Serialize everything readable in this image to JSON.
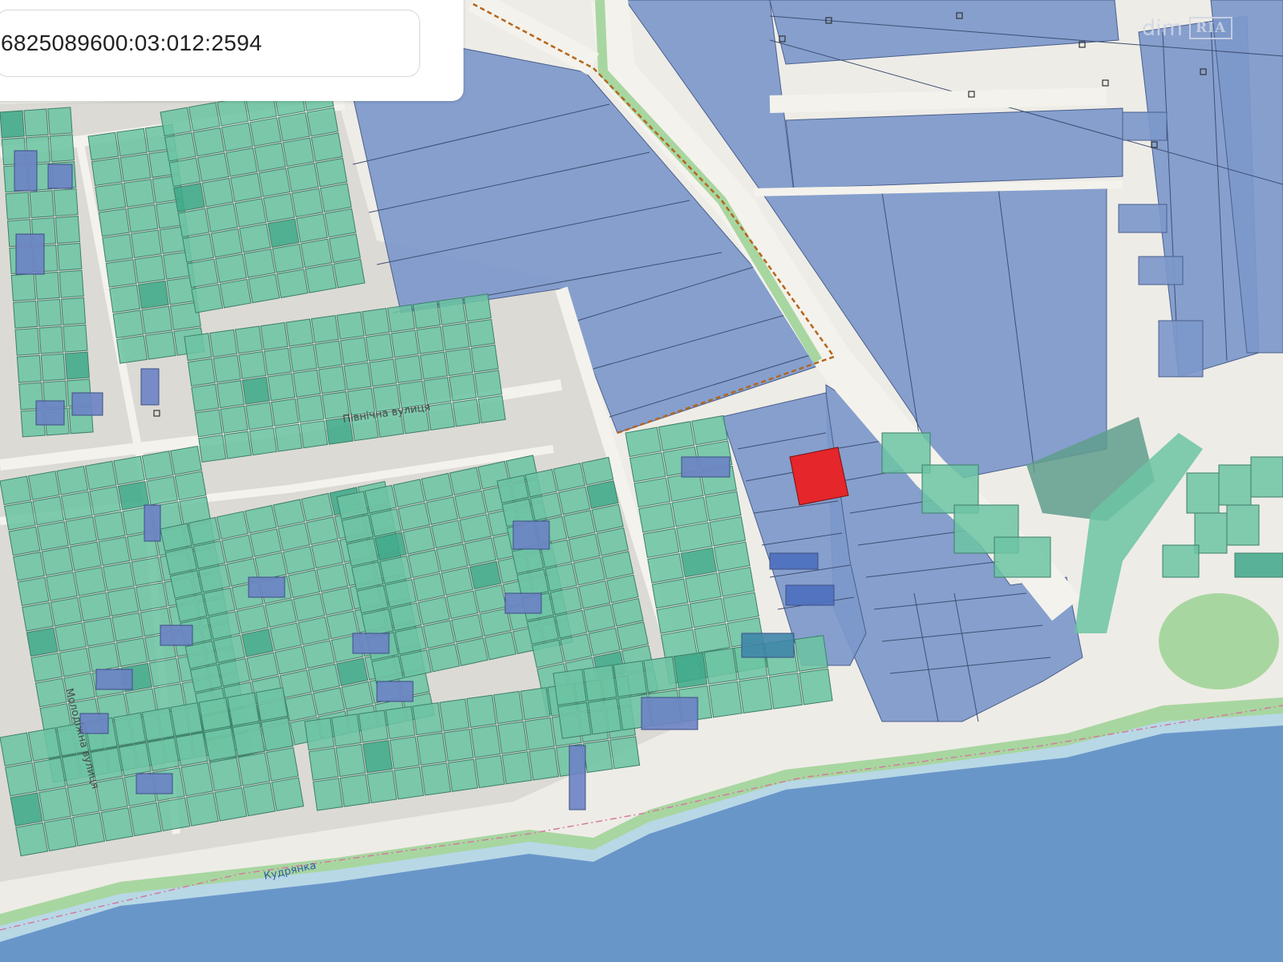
{
  "search": {
    "value": "6825089600:03:012:2594"
  },
  "watermark": {
    "dim": "dim",
    "ria": "RIA"
  },
  "labels": {
    "street_north": "Північна вулиця",
    "street_molodizhna": "Молодіжна вулиця",
    "river": "Кудрянка"
  },
  "colors": {
    "background": "#eeece6",
    "water": "#6996c9",
    "residential_parcel": "#6cc4a3",
    "agricultural_parcel": "#7d98cb",
    "selected_parcel": "#e5262a",
    "road": "#f4f2ec",
    "boundary": "#b5651d",
    "green_strip": "#a8d6a0"
  },
  "icons": {
    "selected_parcel": "selected-parcel-marker",
    "boundary_nodes": "survey-node-icon"
  }
}
